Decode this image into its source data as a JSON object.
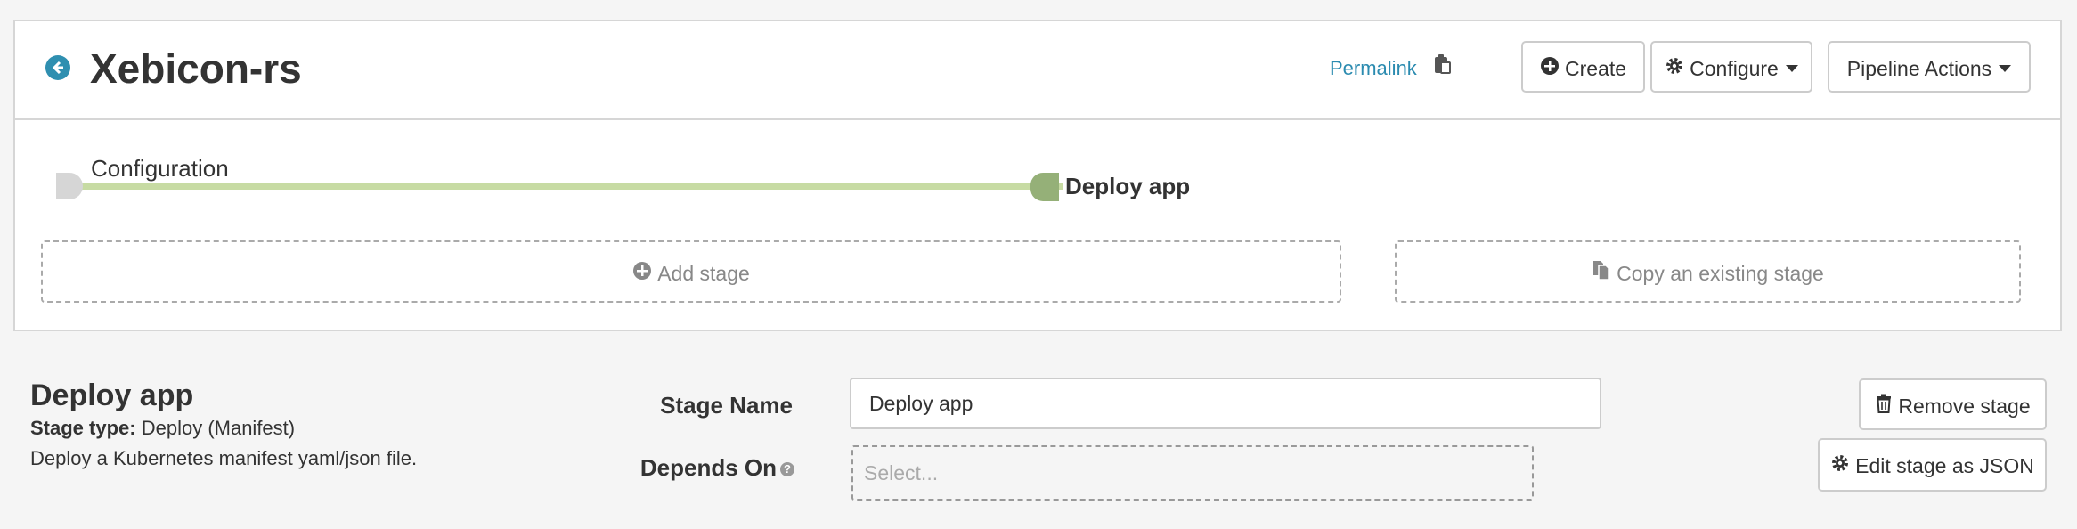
{
  "pipeline": {
    "title": "Xebicon-rs",
    "permalink": "Permalink",
    "buttons": {
      "create": "Create",
      "configure": "Configure",
      "actions": "Pipeline Actions"
    }
  },
  "graph": {
    "stages": [
      {
        "label": "Configuration"
      },
      {
        "label": "Deploy app"
      }
    ],
    "add_stage": "Add stage",
    "copy_stage": "Copy an existing stage"
  },
  "stage": {
    "title": "Deploy app",
    "type_label": "Stage type:",
    "type_value": "Deploy (Manifest)",
    "description": "Deploy a Kubernetes manifest yaml/json file.",
    "name_label": "Stage Name",
    "name_value": "Deploy app",
    "depends_label": "Depends On",
    "depends_placeholder": "Select...",
    "remove_label": "Remove stage",
    "json_label": "Edit stage as JSON"
  },
  "colors": {
    "accent": "#2b8bb0",
    "track": "#c7dba3",
    "node_active": "#95b078",
    "node_start": "#d6d6d6"
  }
}
